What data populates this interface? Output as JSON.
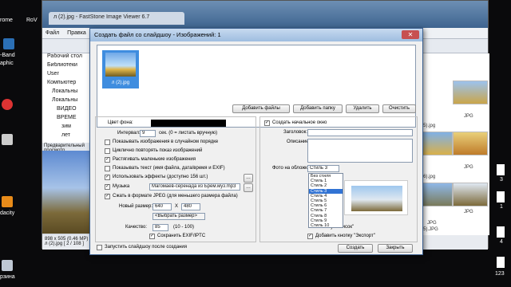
{
  "desktop": {
    "icons": [
      {
        "label": "rome"
      },
      {
        "label": "RoV"
      },
      {
        "label": "-Band"
      },
      {
        "label": "aphic"
      },
      {
        "label": "dacity"
      },
      {
        "label": "рзина"
      }
    ]
  },
  "app": {
    "tab_title": "л (2).jpg - FastStone Image Viewer 6.7",
    "menu": [
      "Файл",
      "Правка",
      "Ци"
    ],
    "tree": [
      "Рабочий стол",
      "Библиотеки",
      "User",
      "Компьютер",
      "Локальны",
      "Локальны",
      "ВИДЕО",
      "ВРЕМЕ",
      "зим",
      "лет"
    ],
    "preview_label": "Предварительный просмотр",
    "status_line1": "898 x 505 (0.46 MP)  24bit  JPG  30 K",
    "status_line2": "л (2).jpg [ 2 / 108 ]",
    "thumb_labels": [
      "JPG",
      "л (5).jpg",
      "JPG",
      "л (6).jpg",
      "JPG",
      "JPG",
      "л (5).JPG"
    ]
  },
  "dialog": {
    "title": "Создать файл со слайдшоу - Изображений: 1",
    "close_label": "✕",
    "file_name": "л (2).jpg",
    "buttons": {
      "add_files": "Добавить файлы",
      "add_folder": "Добавить папку",
      "delete": "Удалить",
      "clear": "Очистить",
      "create": "Создать",
      "close": "Закрыть"
    },
    "left": {
      "bg_color_label": "Цвет фона:",
      "interval_label": "Интервал:",
      "interval_value": "9",
      "interval_hint": "сек.  (0 = листать вручную)",
      "random_order": "Показывать изображения в случайном порядке",
      "loop": "Циклично повторять показ изображений",
      "stretch": "Растягивать маленькие изображения",
      "show_text": "Показывать текст (имя файла, дата/время и EXIF)",
      "effects": "Использовать эффекты (доступно 156 шт.)",
      "music": "Музыка",
      "music_file": "Магомаев-серенада из Брем.муз.mp3",
      "compress": "Сжать в формате JPEG (для меньшего размера файла)",
      "new_size_label": "Новый размер:",
      "width": "640",
      "x": "X",
      "height": "480",
      "choose_size": "<Выбрать размер>",
      "quality_label": "Качество:",
      "quality_value": "85",
      "quality_hint": "(10 - 100)",
      "keep_exif": "Сохранить EXIF/IPTC",
      "run_after": "Запустить слайдшоу после создания"
    },
    "right": {
      "create_start_window": "Создать начальное окно",
      "heading_label": "Заголовок:",
      "description_label": "Описание:",
      "cover_label": "Фото на обложку:",
      "cover_selected": "Стиль 3",
      "styles": [
        "Без стиля",
        "Стиль 1",
        "Стиль 2",
        "Стиль 3",
        "Стиль 4",
        "Стиль 5",
        "Стиль 6",
        "Стиль 7",
        "Стиль 8",
        "Стиль 9",
        "Стиль 10"
      ],
      "selected_index": 3,
      "add_list_button": "кнопку \"Список\"",
      "add_export_button": "Добавить кнопку \"Экспорт\""
    }
  },
  "taskbar_right": {
    "items": [
      "3",
      "1",
      "4",
      "123"
    ]
  },
  "colors": {
    "dialog_border": "#3a5f8f",
    "selection": "#3173d4",
    "thumb_bg": "#3f8ddf"
  }
}
